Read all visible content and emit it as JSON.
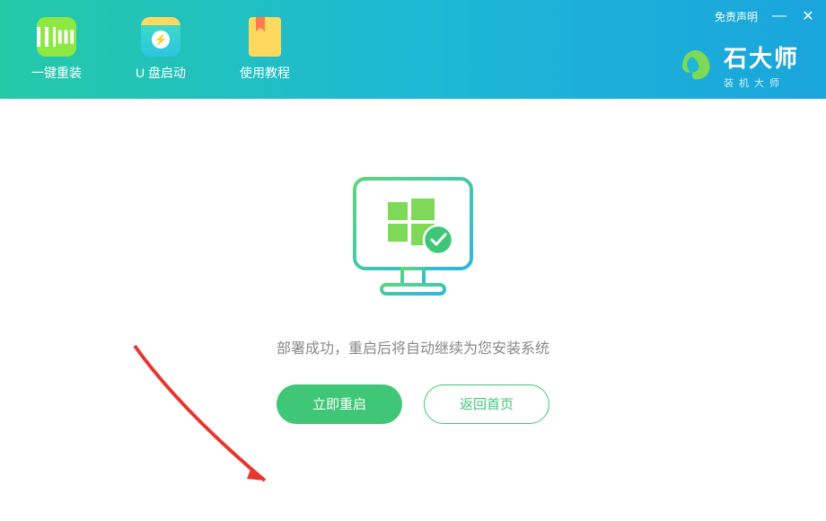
{
  "header": {
    "tabs": [
      {
        "label": "一键重装"
      },
      {
        "label": "U 盘启动"
      },
      {
        "label": "使用教程"
      }
    ],
    "disclaimer": "免责声明",
    "brand": {
      "title": "石大师",
      "subtitle": "装机大师"
    }
  },
  "main": {
    "status_text": "部署成功，重启后将自动继续为您安装系统",
    "restart_label": "立即重启",
    "home_label": "返回首页"
  }
}
